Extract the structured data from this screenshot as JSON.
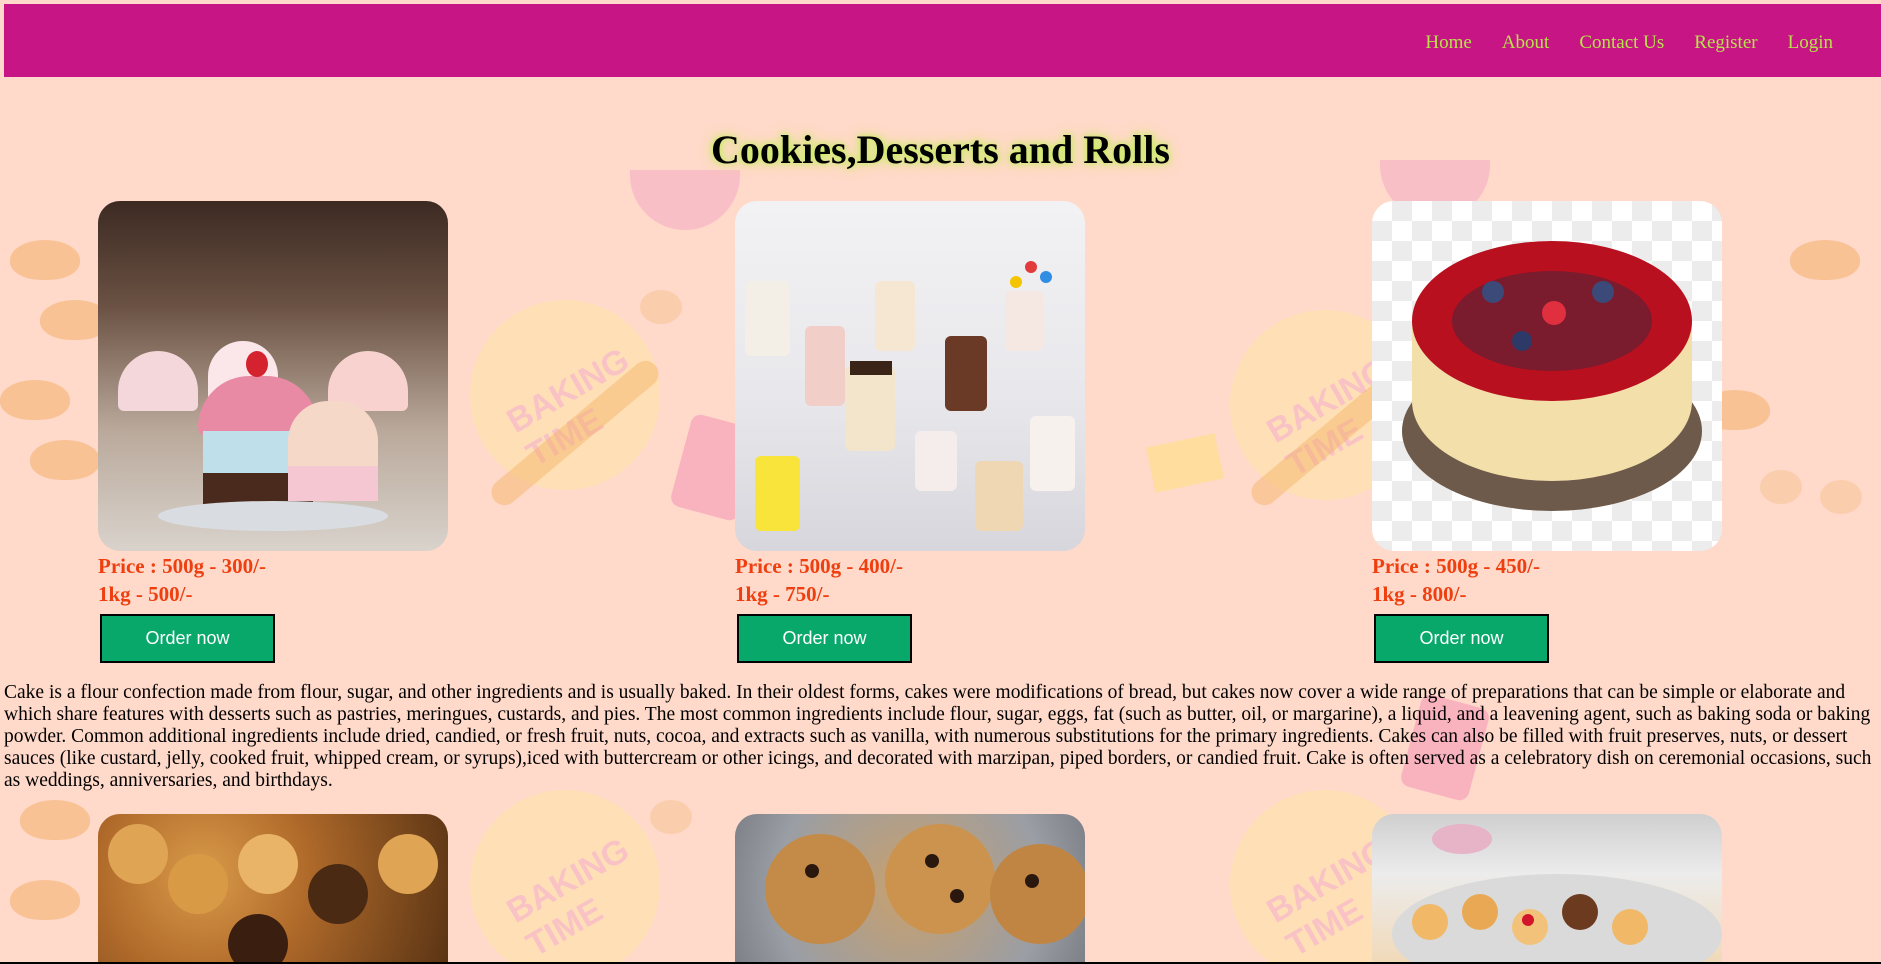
{
  "nav": {
    "links": [
      "Home",
      "About",
      "Contact Us",
      "Register",
      "Login"
    ]
  },
  "page": {
    "title": "Cookies,Desserts and Rolls"
  },
  "products": [
    {
      "image_icon": "cupcakes-photo",
      "price_line1": "Price : 500g - 300/-",
      "price_line2": "1kg - 500/-",
      "button_label": "Order now"
    },
    {
      "image_icon": "assorted-cakes-photo",
      "price_line1": "Price : 500g - 400/-",
      "price_line2": "1kg - 750/-",
      "button_label": "Order now"
    },
    {
      "image_icon": "berry-cheesecake-photo",
      "price_line1": "Price : 500g - 450/-",
      "price_line2": "1kg - 800/-",
      "button_label": "Order now"
    }
  ],
  "description": "Cake is a flour confection made from flour, sugar, and other ingredients and is usually baked. In their oldest forms, cakes were modifications of bread, but cakes now cover a wide range of preparations that can be simple or elaborate and which share features with desserts such as pastries, meringues, custards, and pies. The most common ingredients include flour, sugar, eggs, fat (such as butter, oil, or margarine), a liquid, and a leavening agent, such as baking soda or baking powder. Common additional ingredients include dried, candied, or fresh fruit, nuts, cocoa, and extracts such as vanilla, with numerous substitutions for the primary ingredients. Cakes can also be filled with fruit preserves, nuts, or dessert sauces (like custard, jelly, cooked fruit, whipped cream, or syrups),iced with buttercream or other icings, and decorated with marzipan, piped borders, or candied fruit. Cake is often served as a celebratory dish on ceremonial occasions, such as weddings, anniversaries, and birthdays.",
  "colors": {
    "navbar": "#c71585",
    "nav_link": "#b7e34a",
    "background": "#ffd9c9",
    "price": "#ef3f10",
    "button": "#07a86a"
  },
  "bottom_images": [
    "biscuits-photo",
    "chocolate-chip-cookies-photo",
    "assorted-cookies-photo"
  ]
}
